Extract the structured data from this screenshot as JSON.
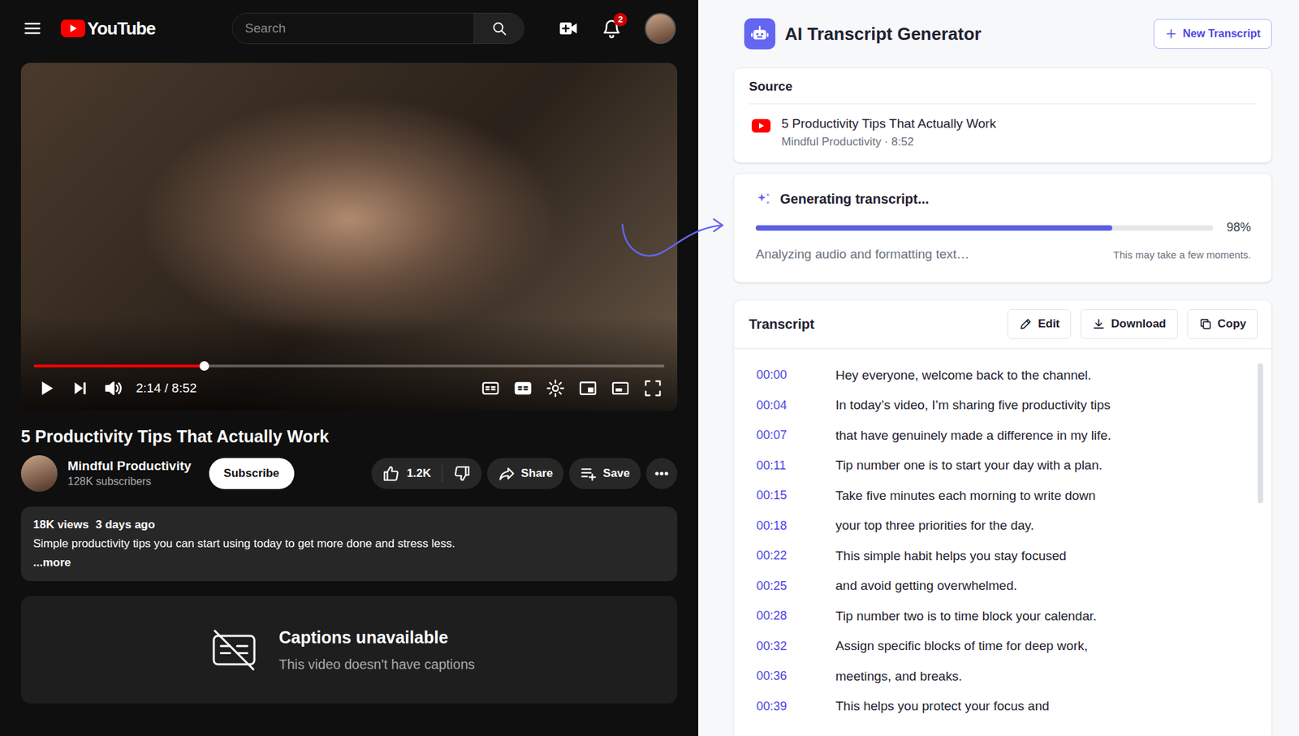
{
  "youtube": {
    "logo": "YouTube",
    "search": {
      "placeholder": "Search"
    },
    "notifications": "2",
    "player": {
      "time": "2:14 / 8:52",
      "level": 0.27
    },
    "video": {
      "title": "5 Productivity Tips That Actually Work",
      "channel": "Mindful Productivity",
      "subscribers": "128K subscribers",
      "subscribe": "Subscribe",
      "likes": "1.2K",
      "share": "Share",
      "save": "Save"
    },
    "description": {
      "views": "18K views",
      "age": "3 days ago",
      "text": "Simple productivity tips you can start using today to get more done and stress less.",
      "more": "...more"
    },
    "captions": {
      "title": "Captions unavailable",
      "subtitle": "This video doesn't have captions"
    }
  },
  "app": {
    "title": "AI Transcript Generator",
    "new_button": "New Transcript",
    "source": {
      "label": "Source",
      "title": "5 Productivity Tips That Actually Work",
      "meta": "Mindful Productivity · 8:52"
    },
    "progress": {
      "title": "Generating transcript...",
      "percent": "98%",
      "level": 0.78,
      "status": "Analyzing audio and formatting text…",
      "note": "This may take a few moments."
    },
    "transcript": {
      "label": "Transcript",
      "actions": [
        {
          "label": "Edit",
          "kind": "edit"
        },
        {
          "label": "Download",
          "kind": "download"
        },
        {
          "label": "Copy",
          "kind": "copy"
        }
      ],
      "lines": [
        {
          "time": "00:00",
          "text": "Hey everyone, welcome back to the channel."
        },
        {
          "time": "00:04",
          "text": "In today’s video, I’m sharing five productivity tips"
        },
        {
          "time": "00:07",
          "text": "that have genuinely made a difference in my life."
        },
        {
          "time": "00:11",
          "text": "Tip number one is to start your day with a plan."
        },
        {
          "time": "00:15",
          "text": "Take five minutes each morning to write down"
        },
        {
          "time": "00:18",
          "text": "your top three priorities for the day."
        },
        {
          "time": "00:22",
          "text": "This simple habit helps you stay focused"
        },
        {
          "time": "00:25",
          "text": "and avoid getting overwhelmed."
        },
        {
          "time": "00:28",
          "text": "Tip number two is to time block your calendar."
        },
        {
          "time": "00:32",
          "text": "Assign specific blocks of time for deep work,"
        },
        {
          "time": "00:36",
          "text": "meetings, and breaks."
        },
        {
          "time": "00:39",
          "text": "This helps you protect your focus and"
        }
      ]
    }
  }
}
